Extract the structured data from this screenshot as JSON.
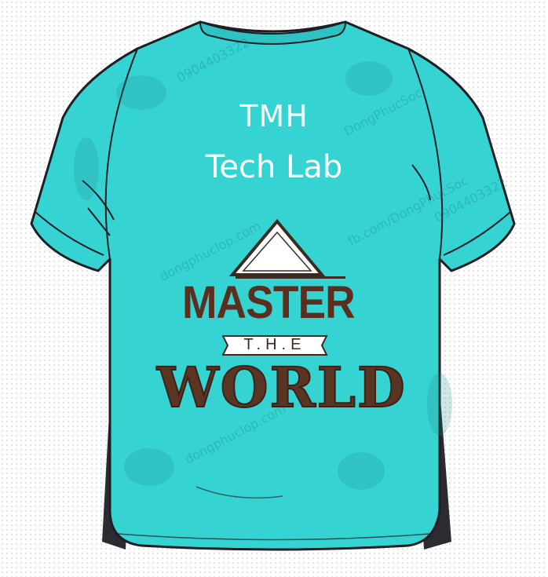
{
  "shirt": {
    "color": "#36d3d3",
    "shadow_color": "#2a2a30",
    "outline_color": "#1e1e24"
  },
  "design": {
    "team_name_line1": "TMH",
    "team_name_line2": "Tech Lab",
    "word_master": "MASTER",
    "word_the": "T.H.E",
    "word_world": "WORLD",
    "text_color": "#5b2f1f"
  },
  "watermarks": {
    "phone": "0904403322",
    "site1": "DongPhucSoc",
    "site2": "dongphuclop.com",
    "site3": "fb.com/DongPhucSoc"
  }
}
